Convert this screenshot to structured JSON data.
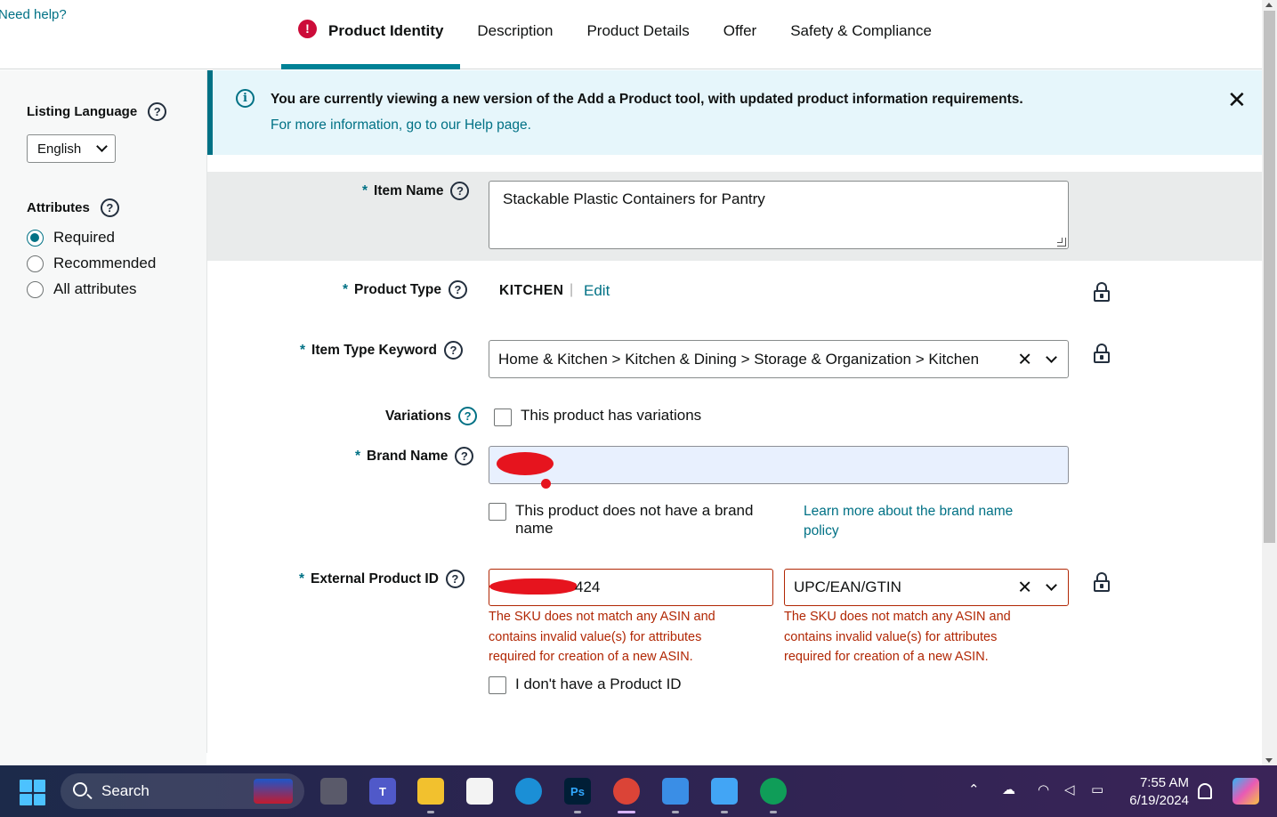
{
  "header": {
    "need_help": "Need help?",
    "tabs": [
      {
        "label": "Product Identity",
        "active": true,
        "error": true
      },
      {
        "label": "Description"
      },
      {
        "label": "Product Details"
      },
      {
        "label": "Offer"
      },
      {
        "label": "Safety & Compliance"
      }
    ],
    "error_glyph": "!"
  },
  "sidebar": {
    "listing_language_label": "Listing Language",
    "language_value": "English",
    "attributes_label": "Attributes",
    "radios": [
      {
        "label": "Required",
        "checked": true
      },
      {
        "label": "Recommended",
        "checked": false
      },
      {
        "label": "All attributes",
        "checked": false
      }
    ]
  },
  "banner": {
    "title": "You are currently viewing a new version of the Add a Product tool, with updated product information requirements.",
    "link": "For more information, go to our Help page.",
    "info_glyph": "i",
    "close_glyph": "✕"
  },
  "form": {
    "item_name": {
      "label": "Item Name",
      "value": "Stackable Plastic Containers for Pantry"
    },
    "product_type": {
      "label": "Product Type",
      "value": "KITCHEN",
      "separator": "|",
      "edit": "Edit"
    },
    "item_type_keyword": {
      "label": "Item Type Keyword",
      "value": "Home & Kitchen > Kitchen & Dining > Storage & Organization > Kitchen"
    },
    "variations": {
      "label": "Variations",
      "checkbox": "This product has variations"
    },
    "brand_name": {
      "label": "Brand Name",
      "no_brand_checkbox": "This product does not have a brand name",
      "learn_more": "Learn more about the brand name policy"
    },
    "external_product_id": {
      "label": "External Product ID",
      "value_suffix": "424",
      "id_type": "UPC/EAN/GTIN",
      "error": "The SKU does not match any ASIN and contains invalid value(s) for attributes required for creation of a new ASIN.",
      "no_id_checkbox": "I don't have a Product ID"
    },
    "required_star": "*",
    "help_glyph": "?",
    "clear_glyph": "✕"
  },
  "taskbar": {
    "search_placeholder": "Search",
    "time": "7:55 AM",
    "date": "6/19/2024",
    "icons": [
      "windows-icon",
      "task-view-icon",
      "teams-icon",
      "file-explorer-icon",
      "store-icon",
      "edge-icon",
      "photoshop-icon",
      "chrome-icon",
      "photos-icon",
      "notepad-icon",
      "chrome-profile-icon"
    ]
  },
  "colors": {
    "accent": "#007185",
    "error": "#b12704",
    "banner_bg": "#e6f6fb"
  }
}
